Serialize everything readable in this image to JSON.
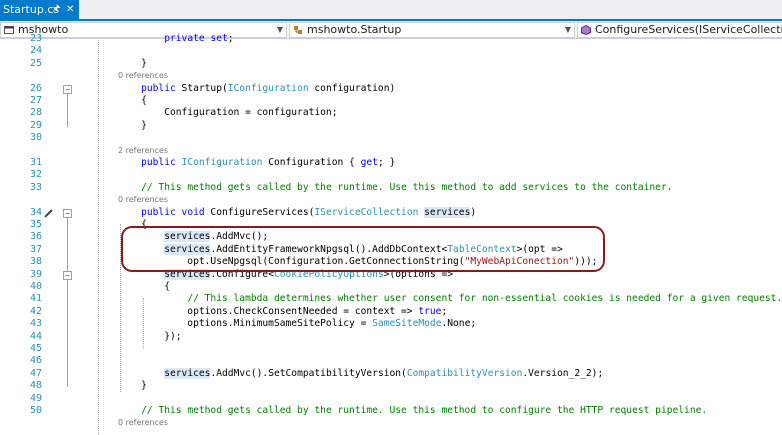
{
  "tab": {
    "title": "Startup.cs",
    "pin_icon": "pin-icon",
    "close_label": "✕"
  },
  "nav": {
    "project": "mshowto",
    "class": "mshowto.Startup",
    "member": "ConfigureServices(IServiceCollection services"
  },
  "editor": {
    "lines": [
      {
        "num": "23",
        "html": "        <span class=\"kw\">private</span> <span class=\"kw\">set</span>;"
      },
      {
        "num": "24",
        "html": ""
      },
      {
        "num": "25",
        "html": "    }"
      },
      {
        "lens": "0 references"
      },
      {
        "num": "26",
        "html": "    <span class=\"kw\">public</span> Startup(<span class=\"ty\">IConfiguration</span> configuration)"
      },
      {
        "num": "27",
        "html": "    {"
      },
      {
        "num": "28",
        "html": "        Configuration = configuration;"
      },
      {
        "num": "29",
        "html": "    }"
      },
      {
        "num": "30",
        "html": ""
      },
      {
        "lens": "2 references"
      },
      {
        "num": "31",
        "html": "    <span class=\"kw\">public</span> <span class=\"ty\">IConfiguration</span> Configuration { <span class=\"kw\">get</span>; }"
      },
      {
        "num": "32",
        "html": ""
      },
      {
        "num": "33",
        "html": "    <span class=\"cm\">// This method gets called by the runtime. Use this method to add services to the container.</span>"
      },
      {
        "lens": "0 references"
      },
      {
        "num": "34",
        "html": "    <span class=\"kw\">public</span> <span class=\"kw\">void</span> ConfigureServices(<span class=\"ty\">IServiceCollection</span> <span class=\"hl\">services</span>)"
      },
      {
        "num": "35",
        "html": "    {"
      },
      {
        "num": "36",
        "html": "        <span class=\"hl\">services</span>.AddMvc();"
      },
      {
        "num": "37",
        "html": "        <span class=\"hl\">services</span>.AddEntityFrameworkNpgsql().AddDbContext&lt;<span class=\"ty\">TableContext</span>&gt;(opt =&gt;"
      },
      {
        "num": "38",
        "html": "            opt.UseNpgsql(Configuration.GetConnectionString(<span class=\"st\">\"MyWebApiConection\"</span>)));"
      },
      {
        "num": "39",
        "html": "        <span class=\"hl\">services</span>.Configure&lt;<span class=\"ty\">CookiePolicyOptions</span>&gt;(options =&gt;"
      },
      {
        "num": "40",
        "html": "        {"
      },
      {
        "num": "41",
        "html": "            <span class=\"cm\">// This lambda determines whether user consent for non-essential cookies is needed for a given request.</span>"
      },
      {
        "num": "42",
        "html": "            options.CheckConsentNeeded = context =&gt; <span class=\"kw\">true</span>;"
      },
      {
        "num": "43",
        "html": "            options.MinimumSameSitePolicy = <span class=\"ty\">SameSiteMode</span>.None;"
      },
      {
        "num": "44",
        "html": "        });"
      },
      {
        "num": "45",
        "html": ""
      },
      {
        "num": "46",
        "html": ""
      },
      {
        "num": "47",
        "html": "        <span class=\"hl\">services</span>.AddMvc().SetCompatibilityVersion(<span class=\"ty\">CompatibilityVersion</span>.Version_2_2);"
      },
      {
        "num": "48",
        "html": "    }"
      },
      {
        "num": "49",
        "html": ""
      },
      {
        "num": "50",
        "html": "    <span class=\"cm\">// This method gets called by the runtime. Use this method to configure the HTTP request pipeline.</span>"
      },
      {
        "lens": "0 references"
      }
    ]
  },
  "colors": {
    "accent": "#007acc",
    "keyword": "#0000ff",
    "type": "#2b91af",
    "comment": "#008000",
    "string": "#a31515",
    "annotation": "#8b1a1a"
  }
}
